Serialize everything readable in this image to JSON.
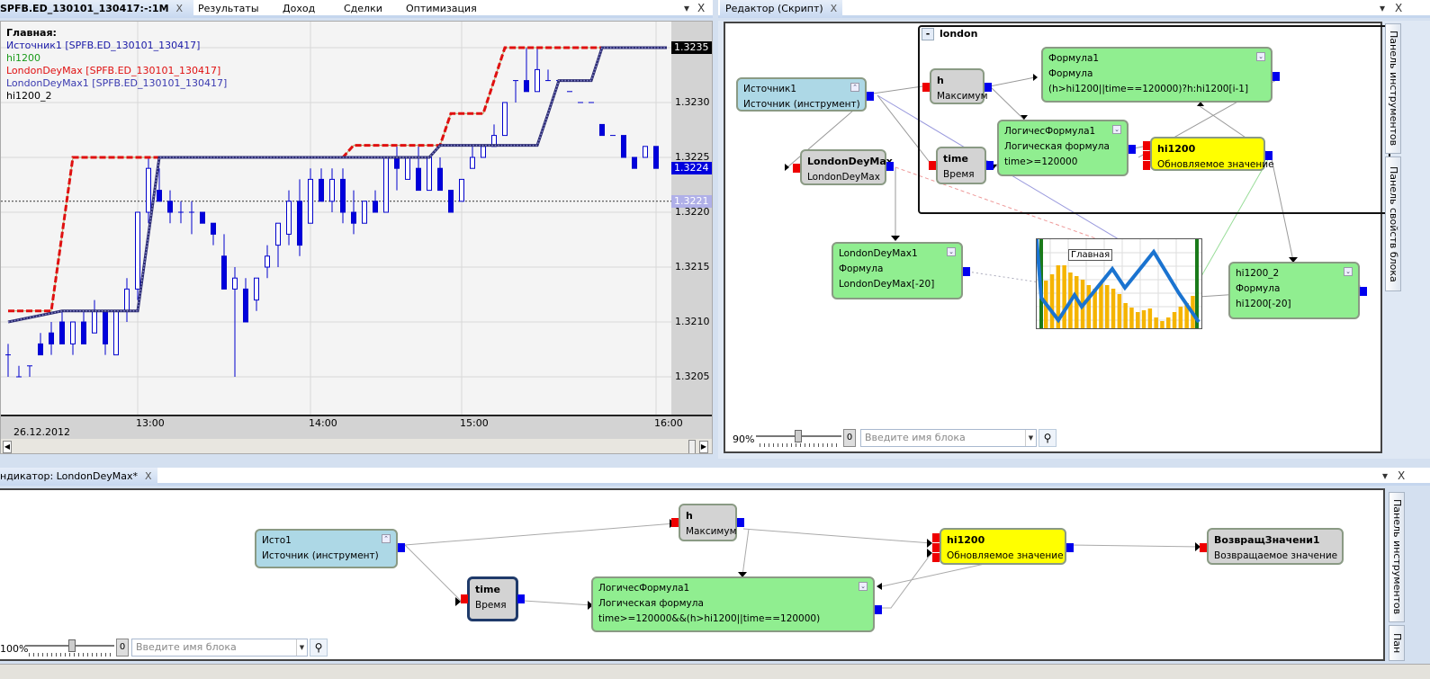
{
  "left_panel": {
    "tabs": [
      {
        "label": "SPFB.ED_130101_130417:-:1M",
        "active": true
      },
      {
        "label": "Результаты"
      },
      {
        "label": "Доход"
      },
      {
        "label": "Сделки"
      },
      {
        "label": "Оптимизация"
      }
    ],
    "close": "X",
    "menu": "▾"
  },
  "chart_data": {
    "type": "candlestick",
    "title": "Главная:",
    "legend": [
      {
        "label": "Источник1 [SPFB.ED_130101_130417]",
        "color": "#1a1aa8"
      },
      {
        "label": "hi1200",
        "color": "#1a9a1a"
      },
      {
        "label": "LondonDeyMax [SPFB.ED_130101_130417]",
        "color": "#e01010"
      },
      {
        "label": "LondonDeyMax1 [SPFB.ED_130101_130417]",
        "color": "#3a3ab0"
      },
      {
        "label": "hi1200_2",
        "color": "#000000"
      }
    ],
    "legend_position": "top-left",
    "date_label": "26.12.2012",
    "ylim": [
      1.3201,
      1.32365
    ],
    "y_ticks": [
      "1.3205",
      "1.3210",
      "1.3215",
      "1.3220",
      "1.3225",
      "1.3230",
      "1.3235"
    ],
    "x_ticks": [
      {
        "label": "13:00",
        "bar": 12
      },
      {
        "label": "14:00",
        "bar": 28
      },
      {
        "label": "15:00",
        "bar": 42
      },
      {
        "label": "16:00",
        "bar": 60
      }
    ],
    "price_markers": [
      {
        "label": "1.3235",
        "value": 1.3235,
        "bg": "#000000",
        "fg": "#ffffff"
      },
      {
        "label": "1.3224",
        "value": 1.3224,
        "bg": "#0000dd",
        "fg": "#ffffff"
      },
      {
        "label": "1.3221",
        "value": 1.3221,
        "bg": "#b0b0e8",
        "fg": "#ffffff"
      }
    ],
    "candles": [
      [
        1.3207,
        1.3208,
        1.3205,
        1.3207
      ],
      [
        1.3205,
        1.3206,
        1.3205,
        1.3205
      ],
      [
        1.3206,
        1.3206,
        1.3205,
        1.3206
      ],
      [
        1.3208,
        1.3209,
        1.3207,
        1.3207
      ],
      [
        1.3209,
        1.321,
        1.3207,
        1.3208
      ],
      [
        1.321,
        1.3211,
        1.3208,
        1.3208
      ],
      [
        1.3208,
        1.321,
        1.3207,
        1.321
      ],
      [
        1.321,
        1.3211,
        1.3208,
        1.3208
      ],
      [
        1.3209,
        1.3212,
        1.3209,
        1.3211
      ],
      [
        1.3211,
        1.3211,
        1.3207,
        1.3208
      ],
      [
        1.3207,
        1.3211,
        1.3207,
        1.3211
      ],
      [
        1.3211,
        1.3214,
        1.321,
        1.3213
      ],
      [
        1.3213,
        1.322,
        1.3212,
        1.322
      ],
      [
        1.322,
        1.3225,
        1.3219,
        1.3224
      ],
      [
        1.3222,
        1.3224,
        1.3221,
        1.3221
      ],
      [
        1.3221,
        1.3222,
        1.3219,
        1.322
      ],
      [
        1.322,
        1.3221,
        1.3219,
        1.322
      ],
      [
        1.322,
        1.3221,
        1.3218,
        1.322
      ],
      [
        1.322,
        1.322,
        1.3219,
        1.3219
      ],
      [
        1.3219,
        1.3219,
        1.3217,
        1.3218
      ],
      [
        1.3216,
        1.3218,
        1.3213,
        1.3213
      ],
      [
        1.3213,
        1.3215,
        1.3205,
        1.3214
      ],
      [
        1.3213,
        1.3214,
        1.321,
        1.321
      ],
      [
        1.3212,
        1.3214,
        1.3211,
        1.3214
      ],
      [
        1.3215,
        1.3217,
        1.3214,
        1.3216
      ],
      [
        1.3217,
        1.3219,
        1.3215,
        1.3219
      ],
      [
        1.3218,
        1.3222,
        1.3217,
        1.3221
      ],
      [
        1.3221,
        1.3223,
        1.3216,
        1.3217
      ],
      [
        1.3219,
        1.3224,
        1.3219,
        1.3223
      ],
      [
        1.3223,
        1.3224,
        1.3221,
        1.3221
      ],
      [
        1.3221,
        1.3224,
        1.322,
        1.3223
      ],
      [
        1.3223,
        1.3224,
        1.3219,
        1.322
      ],
      [
        1.322,
        1.3222,
        1.3218,
        1.3219
      ],
      [
        1.3219,
        1.3221,
        1.3219,
        1.3221
      ],
      [
        1.3221,
        1.3222,
        1.322,
        1.322
      ],
      [
        1.322,
        1.3225,
        1.322,
        1.3225
      ],
      [
        1.3225,
        1.3226,
        1.3222,
        1.3224
      ],
      [
        1.3223,
        1.3225,
        1.3223,
        1.3225
      ],
      [
        1.3224,
        1.3226,
        1.3222,
        1.3222
      ],
      [
        1.3222,
        1.3225,
        1.3222,
        1.3225
      ],
      [
        1.3224,
        1.3225,
        1.3222,
        1.3222
      ],
      [
        1.3222,
        1.3222,
        1.322,
        1.322
      ],
      [
        1.3221,
        1.3223,
        1.3221,
        1.3223
      ],
      [
        1.3224,
        1.3226,
        1.3224,
        1.3225
      ],
      [
        1.3225,
        1.3226,
        1.3225,
        1.3226
      ],
      [
        1.3226,
        1.3228,
        1.3226,
        1.3227
      ],
      [
        1.3227,
        1.323,
        1.3227,
        1.323
      ],
      [
        1.3232,
        1.3232,
        1.323,
        1.3232
      ],
      [
        1.3232,
        1.3235,
        1.3231,
        1.3231
      ],
      [
        1.3231,
        1.3235,
        1.3231,
        1.3233
      ],
      [
        1.3232,
        1.3233,
        1.3232,
        1.3232
      ],
      [
        1.3232,
        1.3232,
        1.3232,
        1.3232
      ],
      [
        1.3231,
        1.3231,
        1.3231,
        1.3231
      ],
      [
        1.323,
        1.323,
        1.323,
        1.323
      ],
      [
        1.323,
        1.323,
        1.323,
        1.323
      ],
      [
        1.3228,
        1.3228,
        1.3227,
        1.3227
      ],
      [
        1.3227,
        1.3227,
        1.3227,
        1.3227
      ],
      [
        1.3227,
        1.3227,
        1.3225,
        1.3225
      ],
      [
        1.3225,
        1.3225,
        1.3224,
        1.3224
      ],
      [
        1.3225,
        1.3226,
        1.3225,
        1.3226
      ],
      [
        1.3226,
        1.3226,
        1.3224,
        1.3224
      ]
    ],
    "series": [
      {
        "name": "LondonDeyMax",
        "color": "#e01010",
        "style": "dashed",
        "points": [
          [
            0,
            1.3211
          ],
          [
            4,
            1.3211
          ],
          [
            6,
            1.3225
          ],
          [
            31,
            1.3225
          ],
          [
            32,
            1.32261
          ],
          [
            40,
            1.32261
          ],
          [
            41,
            1.3229
          ],
          [
            44,
            1.3229
          ],
          [
            45,
            1.3232
          ],
          [
            46,
            1.3235
          ],
          [
            61,
            1.3235
          ]
        ]
      },
      {
        "name": "LondonDeyMax1",
        "color": "#2a2a70",
        "style": "dotted",
        "points": [
          [
            0,
            1.321
          ],
          [
            5,
            1.3211
          ],
          [
            12,
            1.3211
          ],
          [
            14,
            1.3225
          ],
          [
            39,
            1.3225
          ],
          [
            40,
            1.32261
          ],
          [
            49,
            1.32261
          ],
          [
            50,
            1.3229
          ],
          [
            51,
            1.3232
          ],
          [
            54,
            1.3232
          ],
          [
            55,
            1.3235
          ],
          [
            61,
            1.3235
          ]
        ]
      }
    ],
    "dashed_level": 1.3221
  },
  "editor": {
    "tab": "Редактор (Скрипт)",
    "group": {
      "collapse": "-",
      "name": "london"
    },
    "nodes": {
      "src": {
        "title": "Источник1",
        "type": "Источник (инструмент)"
      },
      "h": {
        "title": "h",
        "type": "Максимум"
      },
      "formula1": {
        "title": "Формула1",
        "type": "Формула",
        "expr": "(h>hi1200||time==120000)?h:hi1200[i-1]"
      },
      "logic": {
        "title": "ЛогичесФормула1",
        "type": "Логическая формула",
        "expr": "time>=120000"
      },
      "time": {
        "title": "time",
        "type": "Время"
      },
      "hi1200": {
        "title": "hi1200",
        "type": "Обновляемое значение"
      },
      "ldm": {
        "title": "LondonDeyMax",
        "type": "LondonDeyMax"
      },
      "ldm1": {
        "title": "LondonDeyMax1",
        "type": "Формула",
        "expr": "LondonDeyMax[-20]"
      },
      "chart": {
        "title": "Главная"
      },
      "hi1200_2": {
        "title": "hi1200_2",
        "type": "Формула",
        "expr": "hi1200[-20]"
      }
    },
    "zoom": "90%",
    "zoom_value": 0.9,
    "reset": "0",
    "search_placeholder": "Введите имя блока",
    "side_tabs": [
      "Панель инструментов",
      "Панель свойств блока"
    ]
  },
  "indicator": {
    "tab": "ндикатор: LondonDeyMax*",
    "nodes": {
      "src": {
        "title": "Исто1",
        "type": "Источник (инструмент)"
      },
      "h": {
        "title": "h",
        "type": "Максимум"
      },
      "time": {
        "title": "time",
        "type": "Время"
      },
      "logic": {
        "title": "ЛогичесФормула1",
        "type": "Логическая формула",
        "expr": "time>=120000&&(h>hi1200||time==120000)"
      },
      "hi1200": {
        "title": "hi1200",
        "type": "Обновляемое значение"
      },
      "ret": {
        "title": "ВозвращЗначени1",
        "type": "Возвращаемое значение"
      }
    },
    "zoom": "100%",
    "zoom_value": 1.0,
    "reset": "0",
    "search_placeholder": "Введите имя блока",
    "side_tabs": [
      "Панель инструментов",
      "Пан"
    ]
  },
  "colors": {
    "node_blue": "#add8e6",
    "node_green": "#90ee90",
    "node_gray": "#d3d3d3",
    "node_yellow": "#ffff00",
    "pin_out": "#0000ee",
    "pin_in": "#ee0000"
  }
}
